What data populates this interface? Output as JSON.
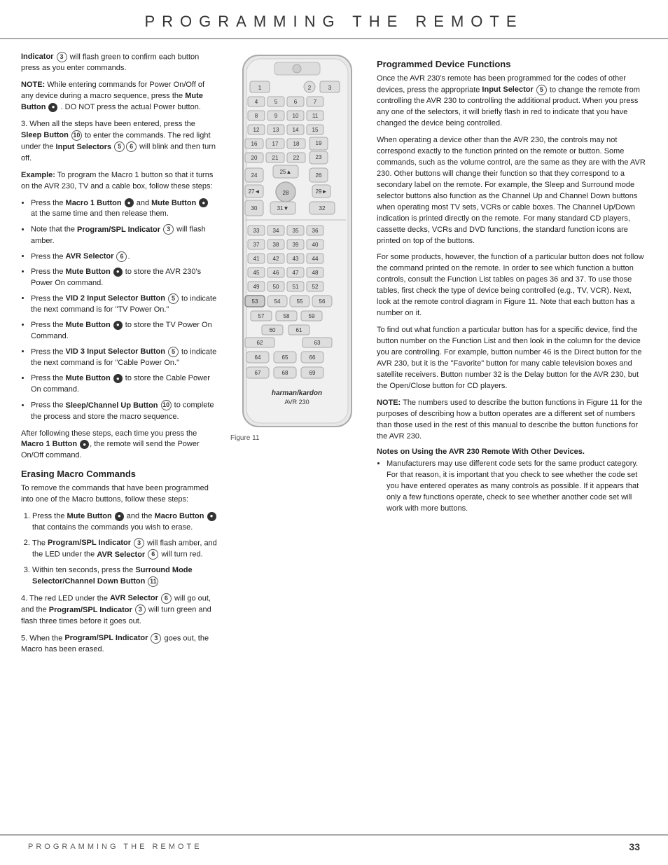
{
  "header": {
    "title": "PROGRAMMING  THE  REMOTE"
  },
  "footer": {
    "left_label": "PROGRAMMING THE REMOTE",
    "page_number": "33"
  },
  "left_col": {
    "intro_text": "Indicator",
    "indicator_num": "3",
    "intro_rest": " will flash green to confirm each button press as you enter commands.",
    "note_label": "NOTE:",
    "note_text": " While entering commands for Power On/Off of any device during a macro sequence, press the ",
    "mute_btn": "Mute Button",
    "note_rest": ". DO NOT press the actual Power button.",
    "step3_intro": "3. When all the steps have been entered, press the ",
    "sleep_btn": "Sleep Button",
    "sleep_num": "10",
    "step3_mid": " to enter the commands. The red light under the ",
    "input_sel": "Input Selectors",
    "input_nums": "5 6",
    "step3_end": " will blink and then turn off.",
    "example_label": "Example:",
    "example_text": " To program the Macro 1 button so that it turns on the AVR 230, TV and a cable box, follow these steps:",
    "bullets": [
      {
        "bold_part": "Macro 1 Button",
        "has_circle": true,
        "circle_type": "filled",
        "extra_bold": "Mute Button",
        "extra_circle": true,
        "text": " Press the  and  at the same time and then release them."
      },
      {
        "bold_part": "Program/SPL Indicator",
        "has_circle": true,
        "circle_num": "3",
        "text": " Note that the  will flash amber."
      },
      {
        "bold_part": "AVR Selector",
        "has_circle": true,
        "circle_num": "6",
        "text": " Press the ."
      },
      {
        "bold_part": "Mute Button",
        "circle_type": "filled",
        "text": " Press the  to store the AVR 230's Power On command."
      },
      {
        "bold_part": "VID 2 Input Selector Button",
        "has_circle": true,
        "circle_num": "5",
        "text": " Press the  to indicate the next command is for \"TV Power On.\""
      },
      {
        "bold_part": "Mute Button",
        "circle_type": "filled",
        "text": " Press the  to store the TV Power On Command."
      },
      {
        "bold_part": "VID 3 Input Selector Button",
        "has_circle": true,
        "circle_num": "5",
        "text": " Press the  to indicate the next command is for \"Cable Power On.\""
      },
      {
        "bold_part": "Mute Button",
        "circle_type": "filled",
        "text": " Press the  to store the Cable Power On command."
      },
      {
        "bold_part": "Sleep/Channel Up Button",
        "has_circle": true,
        "circle_num": "10",
        "text": " Press the  to complete the process and store the macro sequence."
      }
    ],
    "after_bullets": "After following these steps, each time you press the ",
    "macro1_btn": "Macro 1 Button",
    "after_bullets_end": ", the remote will send the Power On/Off command.",
    "erasing_heading": "Erasing Macro Commands",
    "erasing_intro": "To remove the commands that have been programmed into one of the Macro buttons, follow these steps:",
    "erase_steps": [
      {
        "num": "1.",
        "text": "Press the ",
        "bold1": "Mute Button",
        "mid": " and the ",
        "bold2": "Macro Button",
        "end": " that contains the commands you wish to erase."
      },
      {
        "num": "2.",
        "text": "The ",
        "bold1": "Program/SPL Indicator",
        "circle": "3",
        "mid": " will flash amber, and the LED under the ",
        "bold2": "AVR Selector",
        "circle2": "6",
        "end": " will turn red."
      },
      {
        "num": "3.",
        "text": "Within ten seconds, press the ",
        "bold1": "Surround Mode Selector/Channel Down Button",
        "circle": "11",
        "end": ""
      }
    ],
    "step4_text": "4. The red LED under the ",
    "step4_bold1": "AVR Selector",
    "step4_circle1": "6",
    "step4_mid": " will go out, and the ",
    "step4_bold2": "Program/SPL Indicator",
    "step4_circle2": "3",
    "step4_end": " will turn green and flash three times before it goes out.",
    "step5_text": "5. When the ",
    "step5_bold": "Program/SPL Indicator",
    "step5_circle": "3",
    "step5_end": " goes out, the Macro has been erased."
  },
  "center_col": {
    "figure_caption": "Figure 11",
    "brand": "harman/kardon",
    "model": "AVR 230"
  },
  "right_col": {
    "programmed_heading": "Programmed Device Functions",
    "programmed_intro": "Once the AVR 230's remote has been programmed for the codes of other devices, press the appropriate ",
    "input_sel_bold": "Input Selector",
    "input_sel_circle": "5",
    "programmed_mid": " to change the remote from controlling the AVR 230 to controlling the additional product. When you press any one of the selectors, it will briefly flash in red to indicate that you have changed the device being controlled.",
    "para2": "When operating a device other than the AVR 230, the controls may not correspond exactly to the function printed on the remote or button. Some commands, such as the volume control, are the same as they are with the AVR 230. Other buttons will change their function so that they correspond to a secondary label on the remote. For example, the Sleep and Surround mode selector buttons also function as the Channel Up and Channel Down buttons when operating most TV sets, VCRs or cable boxes. The Channel Up/Down indication is printed directly on the remote. For many standard CD players, cassette decks, VCRs and DVD functions, the standard function icons are printed on top of the buttons.",
    "para3": "For some products, however, the function of a particular button does not follow the command printed on the remote. In order to see which function a button controls, consult the Function List tables on pages 36 and 37. To use those tables, first check the type of device being controlled (e.g., TV, VCR). Next, look at the remote control diagram in Figure 11. Note that each button has a number on it.",
    "para4": "To find out what function a particular button has for a specific device, find the button number on the Function List and then look in the column for the device you are controlling. For example, button number 46 is the Direct button for the AVR 230, but it is the \"Favorite\" button for many cable television boxes and satellite receivers. Button number 32 is the Delay button for the AVR 230, but the Open/Close button for CD players.",
    "note2_label": "NOTE:",
    "note2_text": " The numbers used to describe the button functions in Figure 11 for the purposes of describing how a button operates are a different set of numbers than those used in the rest of this manual to describe the button functions for the AVR 230.",
    "notes_heading": "Notes on Using the AVR 230 Remote With Other Devices.",
    "bullet1_bold": "",
    "bullet1_text": "Manufacturers may use different code sets for the same product category. For that reason, it is important that you check to see whether the code set you have entered operates as many controls as possible. If it appears that only a few functions operate, check to see whether another code set will work with more buttons."
  }
}
